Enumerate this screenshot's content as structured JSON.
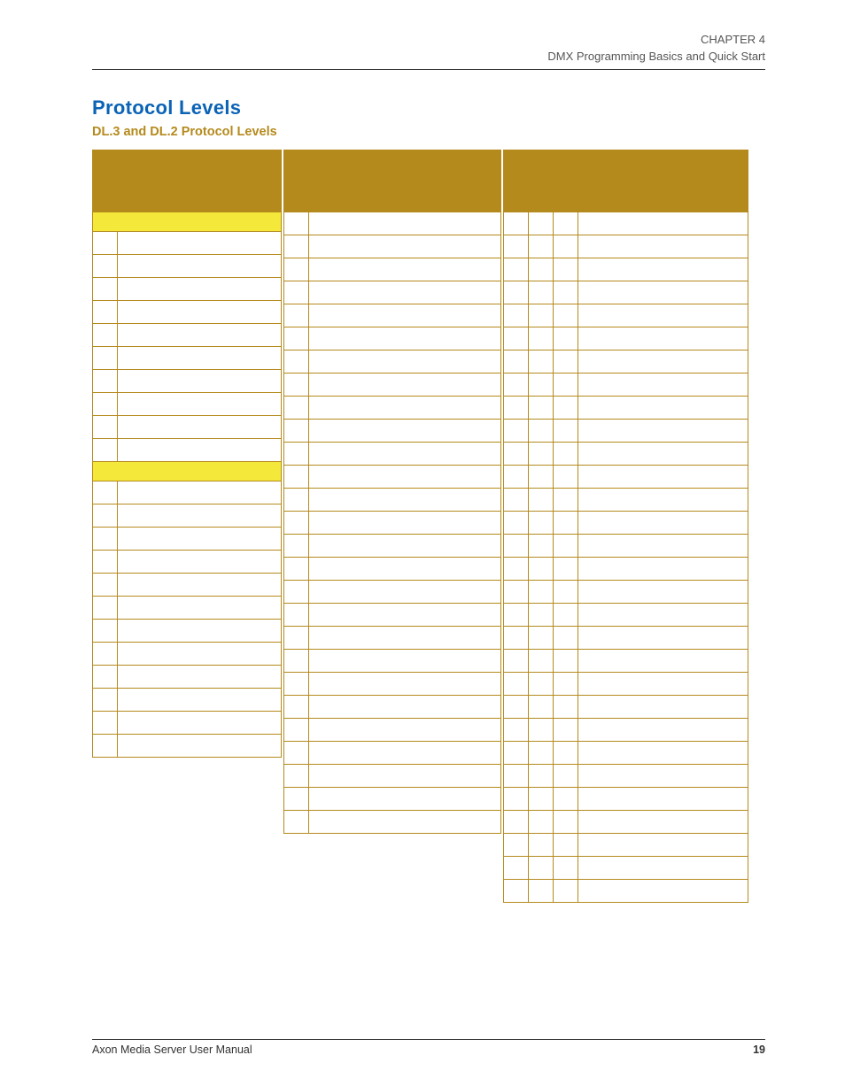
{
  "running_head": {
    "chapter": "CHAPTER 4",
    "subtitle": "DMX Programming Basics and Quick Start"
  },
  "section_title": "Protocol Levels",
  "subsection_title": "DL.3 and DL.2 Protocol Levels",
  "footer": {
    "manual_title": "Axon Media Server User Manual",
    "page_number": "19"
  },
  "blockA": {
    "rows_group1": 10,
    "rows_group2": 12
  },
  "blockB": {
    "body_rows": 27
  },
  "blockC": {
    "body_rows": 30
  }
}
